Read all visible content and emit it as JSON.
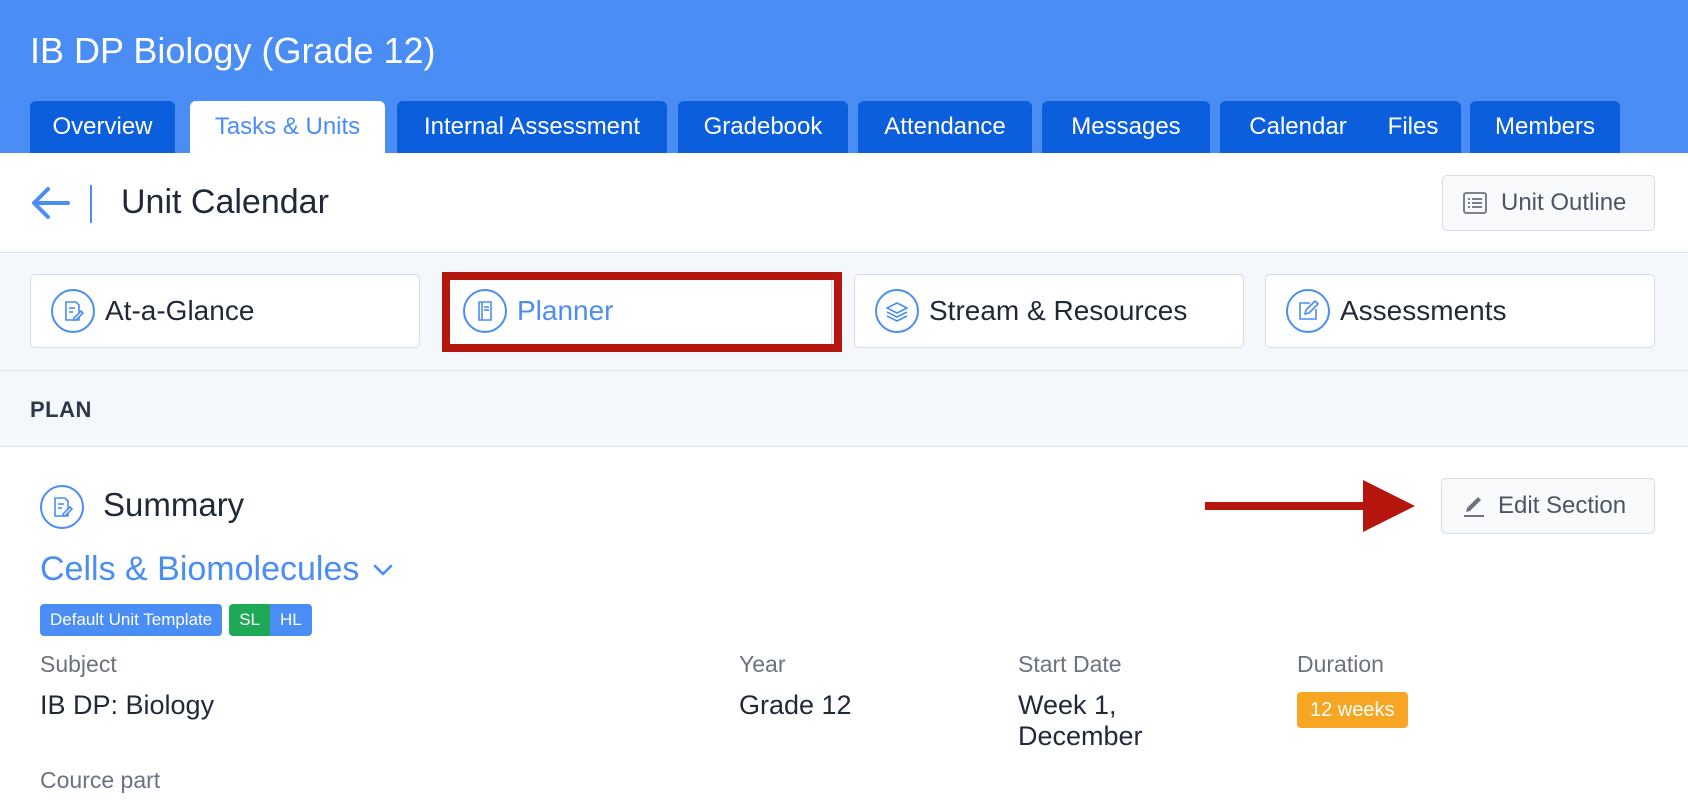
{
  "header": {
    "course_title": "IB DP Biology (Grade 12)",
    "tabs": [
      {
        "label": "Overview"
      },
      {
        "label": "Tasks & Units"
      },
      {
        "label": "Internal Assessment"
      },
      {
        "label": "Gradebook"
      },
      {
        "label": "Attendance"
      },
      {
        "label": "Messages"
      },
      {
        "label": "Calendar"
      },
      {
        "label": "Files"
      },
      {
        "label": "Members"
      }
    ],
    "active_tab": "Tasks & Units"
  },
  "titlebar": {
    "back_icon": "arrow-left-icon",
    "title": "Unit Calendar",
    "outline_button": "Unit Outline",
    "outline_icon": "list-icon"
  },
  "subnav": {
    "items": [
      {
        "label": "At-a-Glance",
        "icon": "document-edit-icon"
      },
      {
        "label": "Planner",
        "icon": "book-icon"
      },
      {
        "label": "Stream & Resources",
        "icon": "layers-icon"
      },
      {
        "label": "Assessments",
        "icon": "edit-square-icon"
      }
    ],
    "active": "Planner",
    "highlight_color": "#b5170f"
  },
  "plan": {
    "section_label": "PLAN"
  },
  "summary": {
    "title": "Summary",
    "icon": "document-edit-icon",
    "edit_button": "Edit Section",
    "edit_icon": "pencil-icon",
    "unit_name": "Cells & Biomolecules",
    "badges": {
      "template": "Default Unit Template",
      "sl": "SL",
      "hl": "HL"
    },
    "fields": {
      "subject_label": "Subject",
      "subject_value": "IB DP: Biology",
      "year_label": "Year",
      "year_value": "Grade 12",
      "start_label": "Start Date",
      "start_line1": "Week 1,",
      "start_line2": "December",
      "duration_label": "Duration",
      "duration_value": "12 weeks",
      "course_part_label": "Cource part"
    }
  },
  "colors": {
    "header_blue": "#4a8ef5",
    "tab_dark_blue": "#0b5fdc",
    "sl_green": "#1fa855",
    "duration_orange": "#f6a623",
    "annotation_red": "#b5170f"
  }
}
